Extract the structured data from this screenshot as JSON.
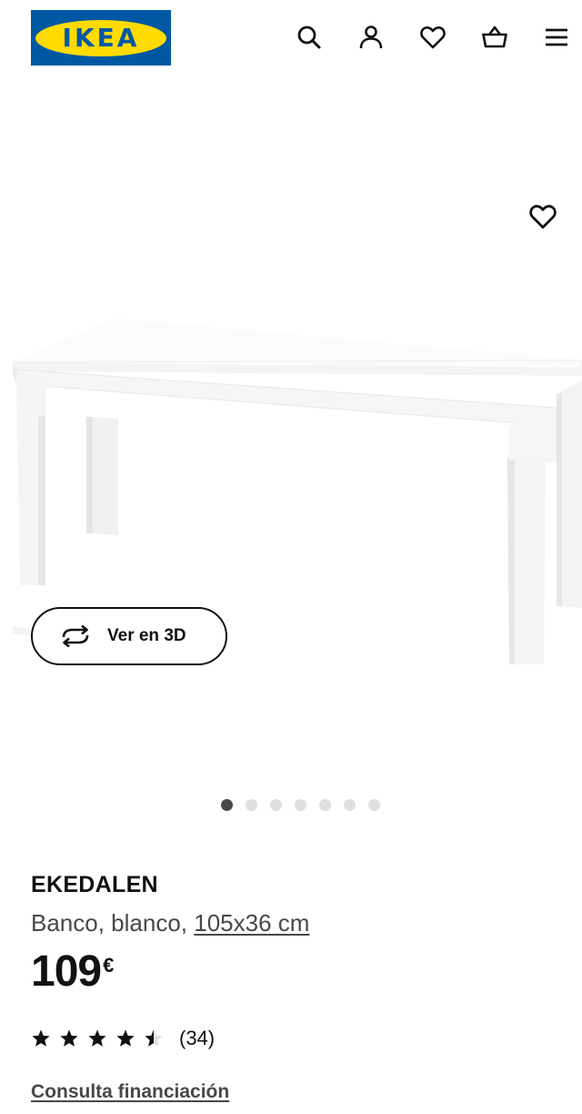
{
  "header": {
    "logo_text": "IKEA",
    "icons": [
      "search-icon",
      "account-icon",
      "favourites-icon",
      "cart-icon",
      "menu-icon"
    ]
  },
  "hero": {
    "favourite_icon": "heart-outline-icon",
    "view3d_label": "Ver en 3D",
    "view3d_icon": "rotate-3d-icon",
    "carousel": {
      "total": 7,
      "active": 1
    }
  },
  "product": {
    "name": "EKEDALEN",
    "description": "Banco, blanco,",
    "dimensions": "105x36 cm",
    "price": "109",
    "currency": "€",
    "rating_value": 4.5,
    "rating_max": 5,
    "review_count": "(34)",
    "financing_link": "Consulta financiación"
  },
  "colors": {
    "brand_blue": "#0058a3",
    "brand_yellow": "#ffdb00",
    "text": "#111111",
    "text_secondary": "#484848"
  }
}
